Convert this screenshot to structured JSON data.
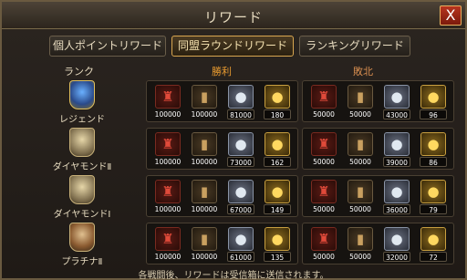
{
  "window": {
    "title": "リワード",
    "close_glyph": "X"
  },
  "tabs": [
    {
      "label": "個人ポイントリワード",
      "active": false
    },
    {
      "label": "同盟ラウンドリワード",
      "active": true
    },
    {
      "label": "ランキングリワード",
      "active": false
    }
  ],
  "headers": {
    "rank": "ランク",
    "win": "勝利",
    "lose": "敗北"
  },
  "rows": [
    {
      "rank": "レジェンド",
      "emblem": "legend-emblem-icon",
      "win": [
        "100000",
        "100000",
        "81000",
        "180"
      ],
      "lose": [
        "50000",
        "50000",
        "43000",
        "96"
      ]
    },
    {
      "rank": "ダイヤモンドⅡ",
      "emblem": "diamond-emblem-icon",
      "win": [
        "100000",
        "100000",
        "73000",
        "162"
      ],
      "lose": [
        "50000",
        "50000",
        "39000",
        "86"
      ]
    },
    {
      "rank": "ダイヤモンドⅠ",
      "emblem": "diamond-emblem-icon",
      "win": [
        "100000",
        "100000",
        "67000",
        "149"
      ],
      "lose": [
        "50000",
        "50000",
        "36000",
        "79"
      ]
    },
    {
      "rank": "プラチナⅡ",
      "emblem": "platinum-emblem-icon",
      "win": [
        "100000",
        "100000",
        "61000",
        "135"
      ],
      "lose": [
        "50000",
        "50000",
        "32000",
        "72"
      ]
    }
  ],
  "item_icons": [
    "food-resource-icon",
    "stone-resource-icon",
    "silver-coin-icon",
    "gold-coin-icon"
  ],
  "colors": {
    "win_header": "#e89a30",
    "lose_header": "#d88e50",
    "active_tab_border": "#d8a650"
  },
  "footer": "各戦闘後、リワードは受信箱に送信されます。"
}
